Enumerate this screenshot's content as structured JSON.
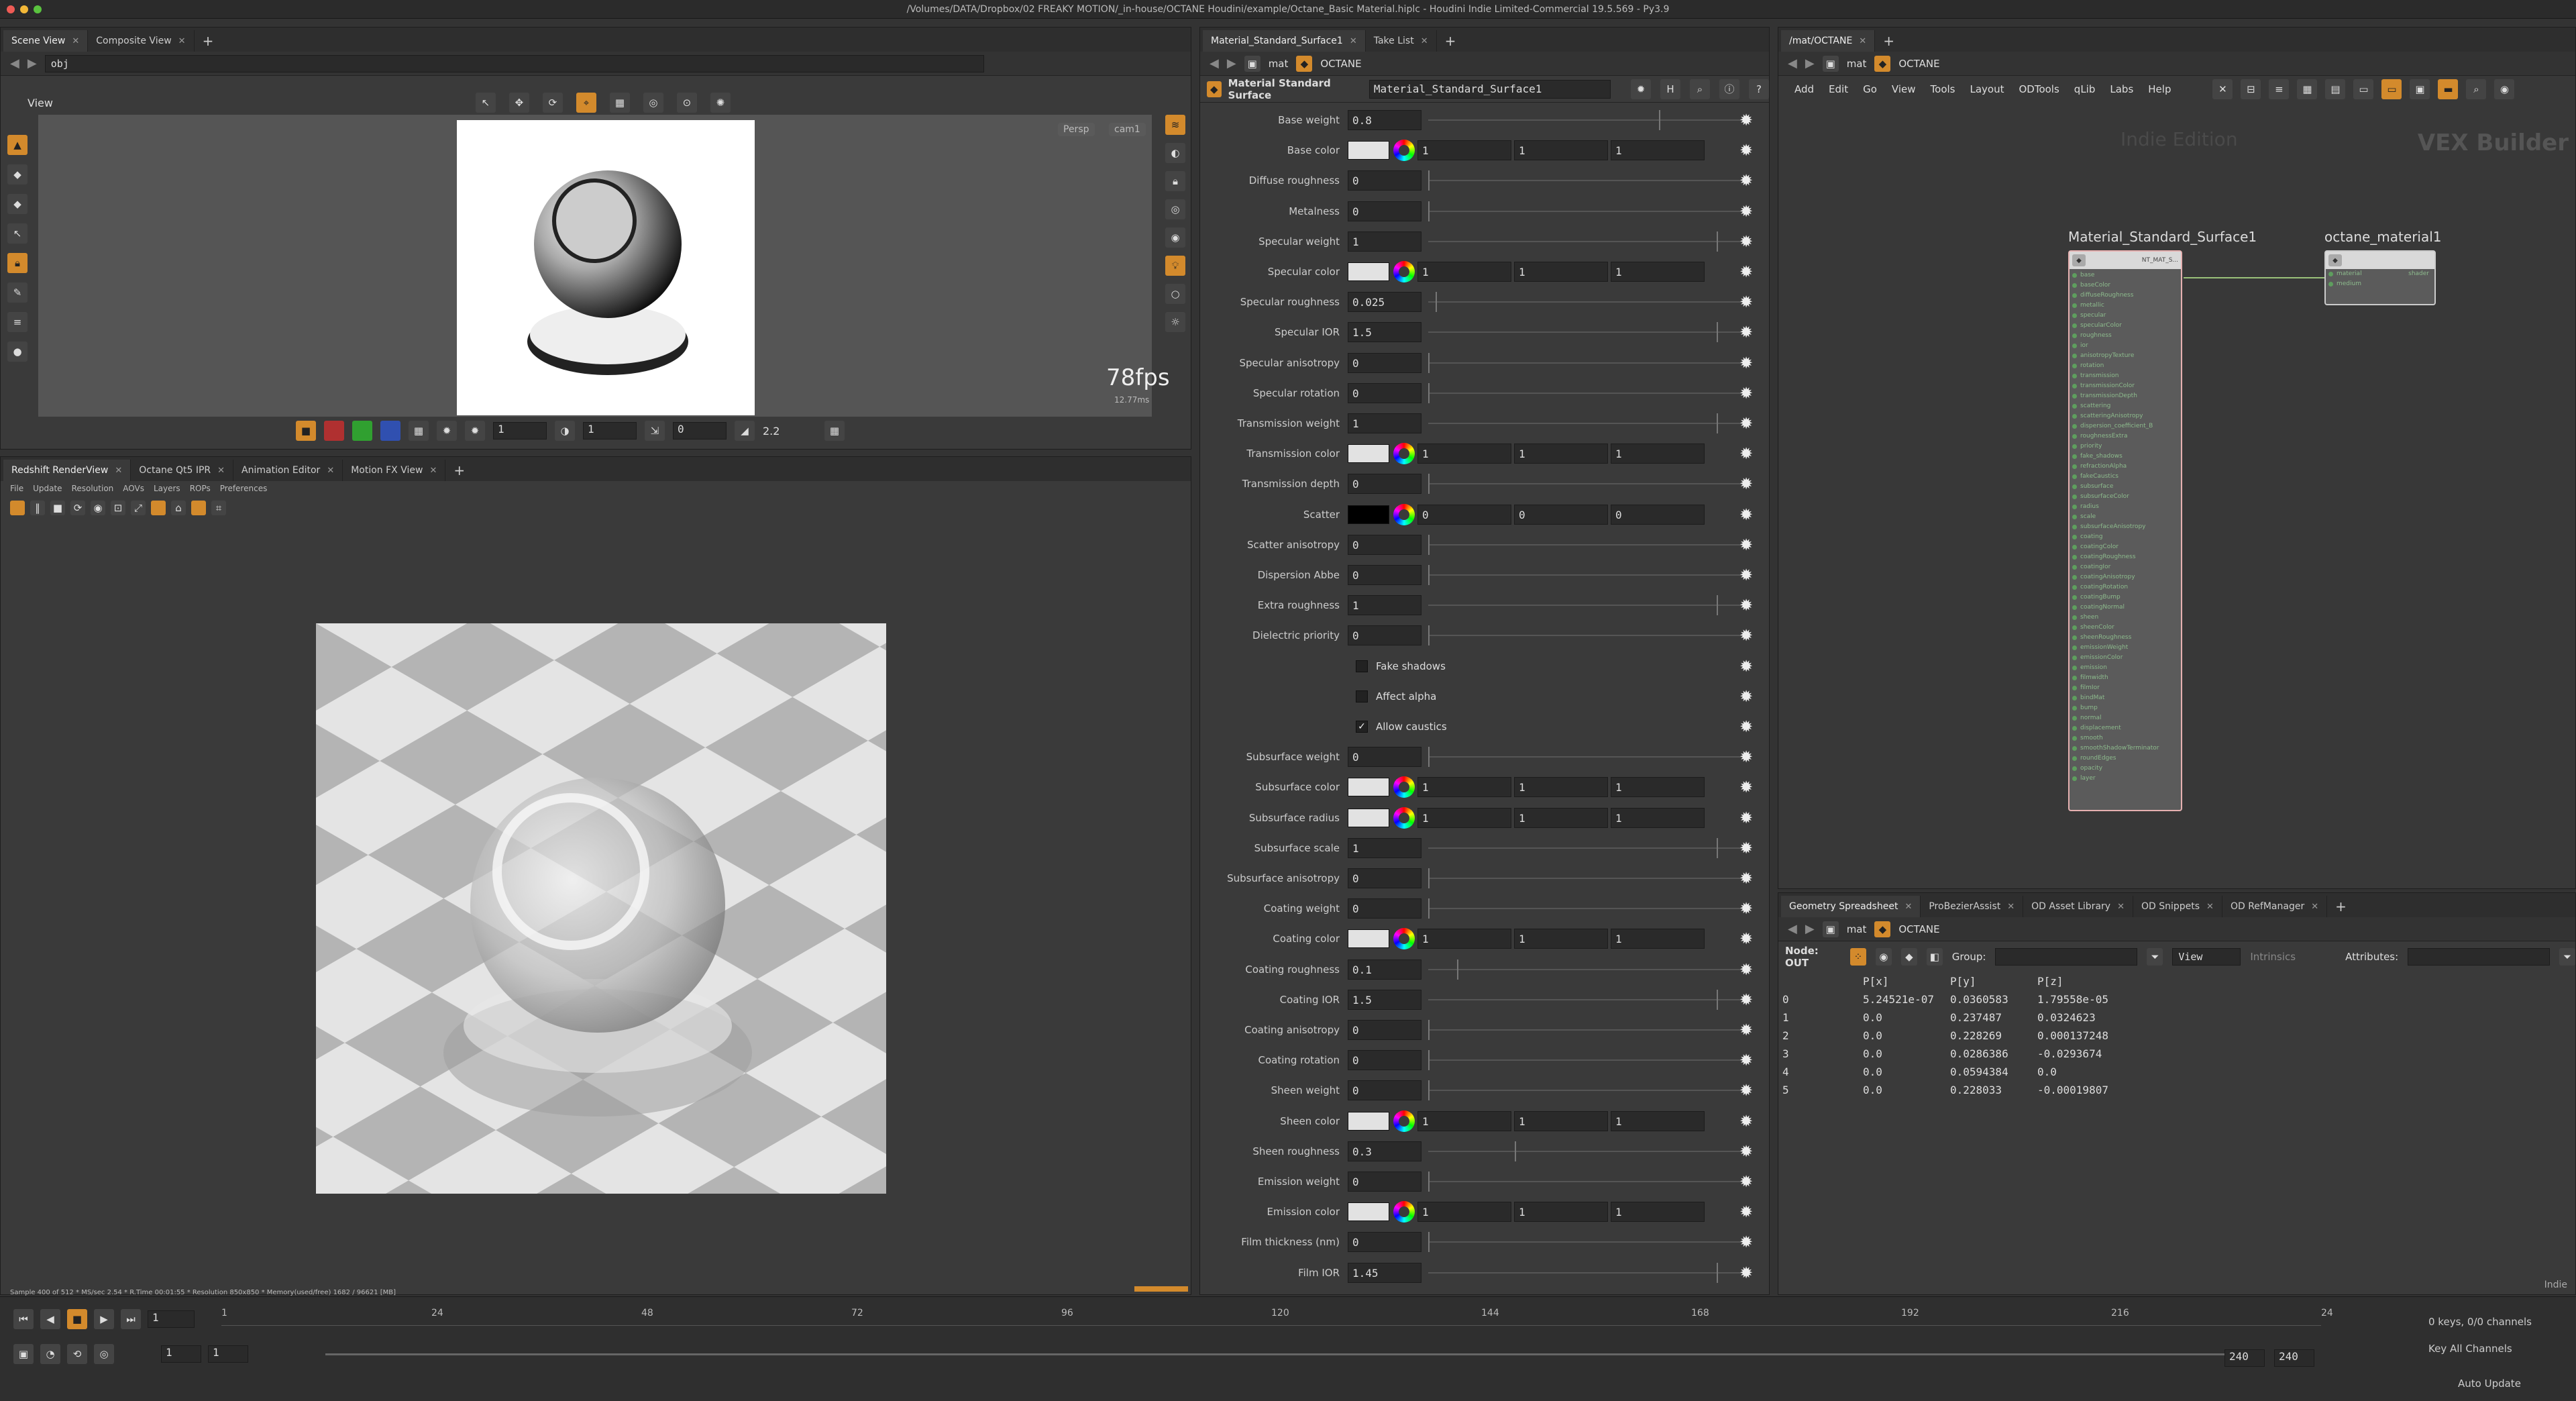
{
  "window_title": "/Volumes/DATA/Dropbox/02 FREAKY MOTION/_in-house/OCTANE Houdini/example/Octane_Basic Material.hiplc - Houdini Indie Limited-Commercial 19.5.569 - Py3.9",
  "colors": {
    "accent": "#d38a2c",
    "panel": "#3a3a3a",
    "dark": "#2a2a2a"
  },
  "scene": {
    "tabs": [
      "Scene View",
      "Composite View"
    ],
    "path": "obj",
    "view_label": "View",
    "persp": "Persp",
    "cam": "cam1",
    "fps": "78fps",
    "ms": "12.77ms",
    "bottom_vals": [
      "1",
      "1",
      "0",
      "2.2"
    ]
  },
  "render": {
    "tabs": [
      "Redshift RenderView",
      "Octane Qt5 IPR",
      "Animation Editor",
      "Motion FX View"
    ],
    "menu": [
      "File",
      "Update",
      "Resolution",
      "AOVs",
      "Layers",
      "ROPs",
      "Preferences"
    ],
    "status": "Sample 400 of 512 * MS/sec 2.54 * R.Time 00:01:55 * Resolution 850x850 * Memory(used/free) 1682 / 96621 [MB]"
  },
  "params": {
    "tabs": [
      "Material_Standard_Surface1",
      "Take List"
    ],
    "path": [
      "mat",
      "OCTANE"
    ],
    "node_type": "Material Standard Surface",
    "node_name": "Material_Standard_Surface1",
    "rows": [
      {
        "label": "Base weight",
        "kind": "num",
        "value": "0.8"
      },
      {
        "label": "Base color",
        "kind": "color",
        "swatch": "#e2e2e2",
        "values": [
          "1",
          "1",
          "1"
        ]
      },
      {
        "label": "Diffuse roughness",
        "kind": "num",
        "value": "0"
      },
      {
        "label": "Metalness",
        "kind": "num",
        "value": "0"
      },
      {
        "label": "Specular weight",
        "kind": "num",
        "value": "1"
      },
      {
        "label": "Specular color",
        "kind": "color",
        "swatch": "#e2e2e2",
        "values": [
          "1",
          "1",
          "1"
        ]
      },
      {
        "label": "Specular roughness",
        "kind": "num",
        "value": "0.025"
      },
      {
        "label": "Specular IOR",
        "kind": "num",
        "value": "1.5"
      },
      {
        "label": "Specular anisotropy",
        "kind": "num",
        "value": "0"
      },
      {
        "label": "Specular rotation",
        "kind": "num",
        "value": "0"
      },
      {
        "label": "Transmission weight",
        "kind": "num",
        "value": "1"
      },
      {
        "label": "Transmission color",
        "kind": "color",
        "swatch": "#e2e2e2",
        "values": [
          "1",
          "1",
          "1"
        ]
      },
      {
        "label": "Transmission depth",
        "kind": "num",
        "value": "0"
      },
      {
        "label": "Scatter",
        "kind": "color",
        "swatch": "#000000",
        "values": [
          "0",
          "0",
          "0"
        ]
      },
      {
        "label": "Scatter anisotropy",
        "kind": "num",
        "value": "0"
      },
      {
        "label": "Dispersion Abbe",
        "kind": "num",
        "value": "0"
      },
      {
        "label": "Extra roughness",
        "kind": "num",
        "value": "1"
      },
      {
        "label": "Dielectric priority",
        "kind": "num",
        "value": "0"
      },
      {
        "label": "Fake shadows",
        "kind": "check",
        "checked": false
      },
      {
        "label": "Affect alpha",
        "kind": "check",
        "checked": false
      },
      {
        "label": "Allow caustics",
        "kind": "check",
        "checked": true
      },
      {
        "label": "Subsurface weight",
        "kind": "num",
        "value": "0"
      },
      {
        "label": "Subsurface color",
        "kind": "color",
        "swatch": "#e2e2e2",
        "values": [
          "1",
          "1",
          "1"
        ]
      },
      {
        "label": "Subsurface radius",
        "kind": "color",
        "swatch": "#e2e2e2",
        "values": [
          "1",
          "1",
          "1"
        ]
      },
      {
        "label": "Subsurface scale",
        "kind": "num",
        "value": "1"
      },
      {
        "label": "Subsurface anisotropy",
        "kind": "num",
        "value": "0"
      },
      {
        "label": "Coating weight",
        "kind": "num",
        "value": "0"
      },
      {
        "label": "Coating color",
        "kind": "color",
        "swatch": "#e2e2e2",
        "values": [
          "1",
          "1",
          "1"
        ]
      },
      {
        "label": "Coating roughness",
        "kind": "num",
        "value": "0.1"
      },
      {
        "label": "Coating IOR",
        "kind": "num",
        "value": "1.5"
      },
      {
        "label": "Coating anisotropy",
        "kind": "num",
        "value": "0"
      },
      {
        "label": "Coating rotation",
        "kind": "num",
        "value": "0"
      },
      {
        "label": "Sheen weight",
        "kind": "num",
        "value": "0"
      },
      {
        "label": "Sheen color",
        "kind": "color",
        "swatch": "#e2e2e2",
        "values": [
          "1",
          "1",
          "1"
        ]
      },
      {
        "label": "Sheen roughness",
        "kind": "num",
        "value": "0.3"
      },
      {
        "label": "Emission weight",
        "kind": "num",
        "value": "0"
      },
      {
        "label": "Emission color",
        "kind": "color",
        "swatch": "#e2e2e2",
        "values": [
          "1",
          "1",
          "1"
        ]
      },
      {
        "label": "Film thickness (nm)",
        "kind": "num",
        "value": "0"
      },
      {
        "label": "Film IOR",
        "kind": "num",
        "value": "1.45"
      }
    ]
  },
  "network": {
    "tab": "/mat/OCTANE",
    "path": [
      "mat",
      "OCTANE"
    ],
    "menu": [
      "Add",
      "Edit",
      "Go",
      "View",
      "Tools",
      "Layout",
      "ODTools",
      "qLib",
      "Labs",
      "Help"
    ],
    "watermark": "Indie Edition",
    "context": "VEX Builder",
    "node1": {
      "name": "Material_Standard_Surface1",
      "out": "NT_MAT_S...",
      "ports": [
        "base",
        "baseColor",
        "diffuseRoughness",
        "metallic",
        "specular",
        "specularColor",
        "roughness",
        "ior",
        "anisotropyTexture",
        "rotation",
        "transmission",
        "transmissionColor",
        "transmissionDepth",
        "scattering",
        "scatteringAnisotropy",
        "dispersion_coefficient_B",
        "roughnessExtra",
        "priority",
        "fake_shadows",
        "refractionAlpha",
        "fakeCaustics",
        "subsurface",
        "subsurfaceColor",
        "radius",
        "scale",
        "subsurfaceAnisotropy",
        "coating",
        "coatingColor",
        "coatingRoughness",
        "coatingIor",
        "coatingAnisotropy",
        "coatingRotation",
        "coatingBump",
        "coatingNormal",
        "sheen",
        "sheenColor",
        "sheenRoughness",
        "emissionWeight",
        "emissionColor",
        "emission",
        "filmwidth",
        "filmIor",
        "bindMat",
        "bump",
        "normal",
        "displacement",
        "smooth",
        "smoothShadowTerminator",
        "roundEdges",
        "opacity",
        "layer"
      ]
    },
    "node2": {
      "name": "octane_material1",
      "ports": [
        "material",
        "medium"
      ],
      "out": "shader"
    }
  },
  "spreadsheet": {
    "tabs": [
      "Geometry Spreadsheet",
      "ProBezierAssist",
      "OD Asset Library",
      "OD Snippets",
      "OD RefManager"
    ],
    "path": [
      "mat",
      "OCTANE"
    ],
    "node_label": "Node: OUT",
    "group_label": "Group:",
    "view_label": "View",
    "intrinsics": "Intrinsics",
    "attributes_label": "Attributes:",
    "columns": [
      "",
      "P[x]",
      "P[y]",
      "P[z]"
    ],
    "rows": [
      [
        "0",
        "5.24521e-07",
        "0.0360583",
        "1.79558e-05"
      ],
      [
        "1",
        "0.0",
        "0.237487",
        "0.0324623"
      ],
      [
        "2",
        "0.0",
        "0.228269",
        "0.000137248"
      ],
      [
        "3",
        "0.0",
        "0.0286386",
        "-0.0293674"
      ],
      [
        "4",
        "0.0",
        "0.0594384",
        "0.0"
      ],
      [
        "5",
        "0.0",
        "0.228033",
        "-0.00019807"
      ]
    ]
  },
  "timeline": {
    "ticks": [
      "1",
      "24",
      "48",
      "72",
      "96",
      "120",
      "144",
      "168",
      "192",
      "216",
      "24"
    ],
    "current_frame": "1",
    "start": "1",
    "start2": "1",
    "end": "240",
    "end2": "240",
    "keys": "0 keys, 0/0 channels",
    "key_all": "Key All Channels",
    "auto_update": "Auto Update",
    "indie": "Indie"
  }
}
